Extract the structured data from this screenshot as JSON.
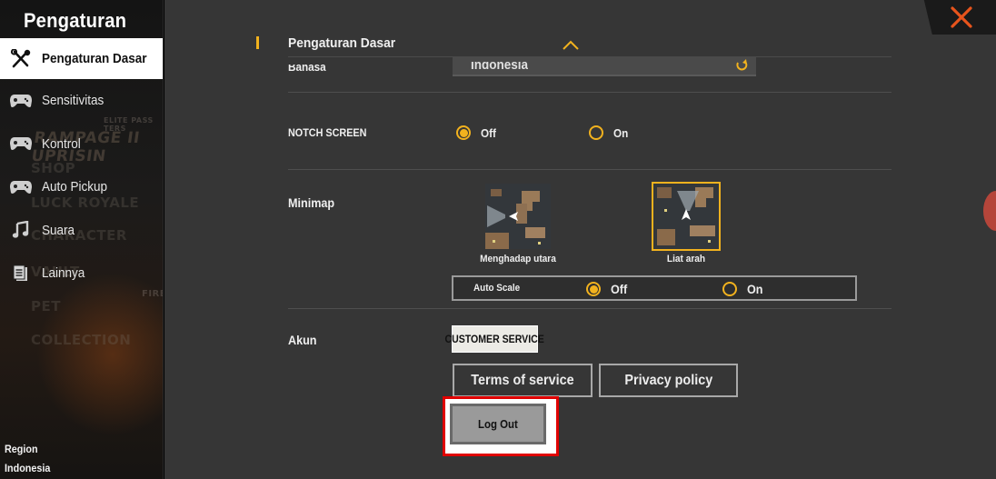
{
  "sidebar": {
    "title": "Pengaturan",
    "items": [
      {
        "label": "Pengaturan Dasar",
        "icon": "tools-icon",
        "active": true
      },
      {
        "label": "Sensitivitas",
        "icon": "gamepad-icon"
      },
      {
        "label": "Kontrol",
        "icon": "gamepad-icon"
      },
      {
        "label": "Auto Pickup",
        "icon": "gamepad-icon"
      },
      {
        "label": "Suara",
        "icon": "music-note-icon"
      },
      {
        "label": "Lainnya",
        "icon": "document-icon"
      }
    ],
    "background_text": {
      "elite_pass": "ELITE PASS TERS",
      "rampage": "RAMPAGE II UPRISIN",
      "shop": "SHOP",
      "luck_royale": "LUCK ROYALE",
      "character": "CHARACTER",
      "vault": "VAULT",
      "pet": "PET",
      "collection": "COLLECTION",
      "fire": "FIRE"
    },
    "region_label": "Region",
    "region_value": "Indonesia"
  },
  "main": {
    "section_title": "Pengaturan Dasar",
    "language": {
      "label": "Bahasa",
      "value": "Indonesia"
    },
    "notch": {
      "label": "NOTCH SCREEN",
      "options": [
        "Off",
        "On"
      ],
      "selected": "Off"
    },
    "minimap": {
      "label": "Minimap",
      "options": [
        {
          "caption": "Menghadap utara"
        },
        {
          "caption": "Liat arah",
          "selected": true
        }
      ],
      "auto_scale": {
        "label": "Auto Scale",
        "options": [
          "Off",
          "On"
        ],
        "selected": "Off"
      }
    },
    "account": {
      "label": "Akun",
      "customer_service": "CUSTOMER SERVICE",
      "terms": "Terms of service",
      "privacy": "Privacy policy",
      "logout": "Log Out"
    }
  },
  "colors": {
    "accent": "#f2b21e",
    "highlight": "#e00000",
    "close": "#e8541c",
    "panel": "#363636"
  }
}
